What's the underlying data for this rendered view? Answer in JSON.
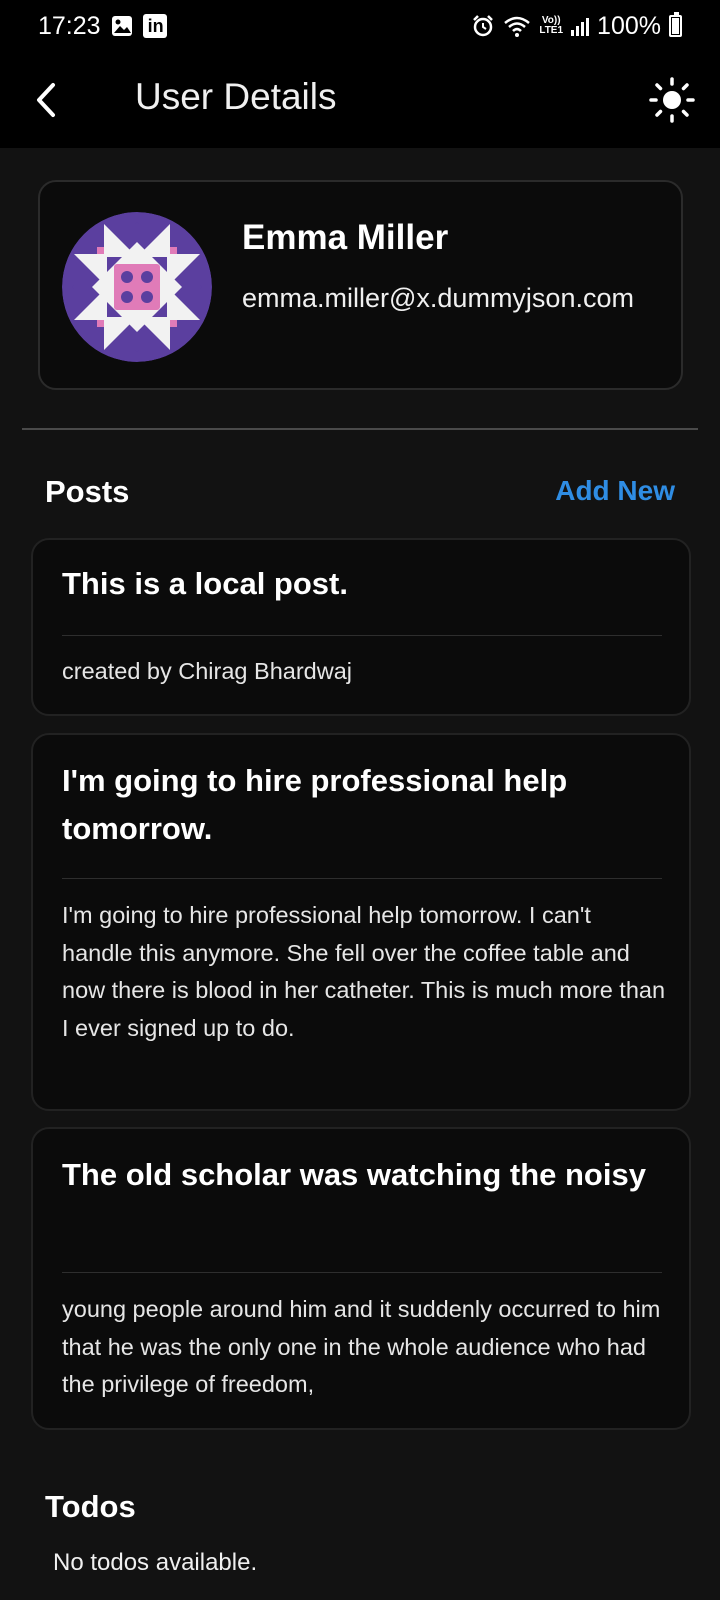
{
  "status_bar": {
    "time": "17:23",
    "left_icons": [
      "image-icon",
      "linkedin-icon"
    ],
    "linkedin_label": "in",
    "network_top": "Vo))",
    "network_bottom": "LTE1",
    "battery": "100%"
  },
  "app_bar": {
    "title": "User Details",
    "back_icon": "chevron-left-icon",
    "theme_icon": "sun-icon"
  },
  "profile": {
    "name": "Emma Miller",
    "email": "emma.miller@x.dummyjson.com",
    "avatar_colors": [
      "#5b3f9f",
      "#e07bb8",
      "#f2f2f2"
    ]
  },
  "posts": {
    "title": "Posts",
    "add_label": "Add New",
    "items": [
      {
        "title": "This is a local post.",
        "body": "created by Chirag Bhardwaj"
      },
      {
        "title": "I'm going to hire professional help tomorrow.",
        "body": "I'm going to hire professional help tomorrow. I can't handle this anymore. She fell over the coffee table and now there is blood in her catheter. This is much more than I ever signed up to do."
      },
      {
        "title": "The old scholar was watching the noisy",
        "body": "young people around him and it suddenly occurred to him that he was the only one in the whole audience who had the privilege of freedom,"
      }
    ]
  },
  "todos": {
    "title": "Todos",
    "empty_text": "No todos available."
  },
  "colors": {
    "background": "#121212",
    "bar": "#000000",
    "accent": "#2f8de4",
    "card": "#0b0b0b"
  }
}
